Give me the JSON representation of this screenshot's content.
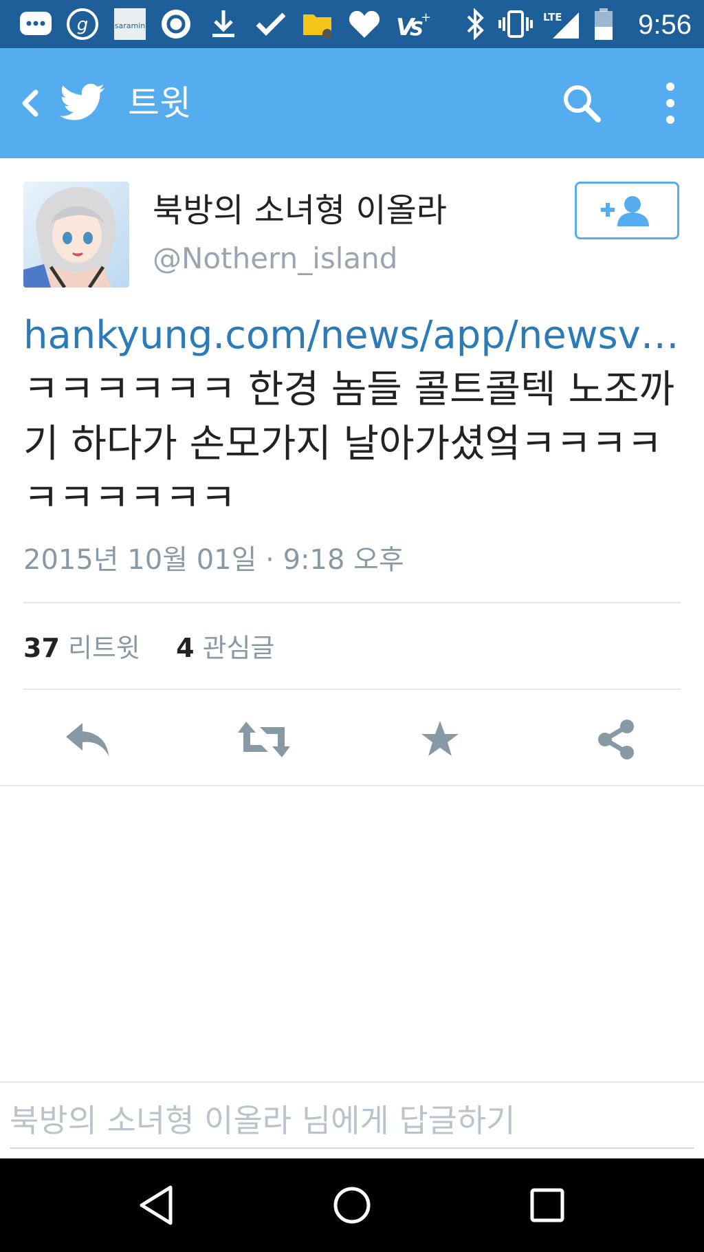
{
  "status_bar": {
    "time": "9:56",
    "left_icons": [
      "message-icon",
      "g-app-icon",
      "saramin-icon",
      "circle-app-icon",
      "download-icon",
      "check-icon",
      "folder-icon",
      "heart-icon",
      "vs-plus-icon"
    ],
    "right_icons": [
      "bluetooth-icon",
      "vibrate-icon",
      "lte-signal-icon",
      "battery-icon"
    ],
    "saramin_label": "saramin",
    "lte_label": "LTE"
  },
  "app_bar": {
    "title": "트윗",
    "color": "#55acee"
  },
  "tweet": {
    "display_name": "북방의 소녀형 이올라",
    "handle": "@Nothern_island",
    "link_text": "hankyung.com/news/app/newsv…",
    "body_text": " ㅋㅋㅋㅋㅋㅋ 한경 놈들 콜트콜텍 노조까기 하다가 손모가지 날아가셨엌ㅋㅋㅋㅋㅋㅋㅋㅋㅋㅋ",
    "timestamp": "2015년 10월 01일 · 9:18 오후",
    "retweet_count": "37",
    "retweet_label": "리트윗",
    "favorite_count": "4",
    "favorite_label": "관심글"
  },
  "actions": [
    "reply-icon",
    "retweet-icon",
    "favorite-star-icon",
    "share-icon"
  ],
  "reply": {
    "placeholder": "북방의 소녀형 이올라 님에게 답글하기"
  },
  "nav_bar": [
    "back-triangle-icon",
    "home-circle-icon",
    "recents-square-icon"
  ]
}
